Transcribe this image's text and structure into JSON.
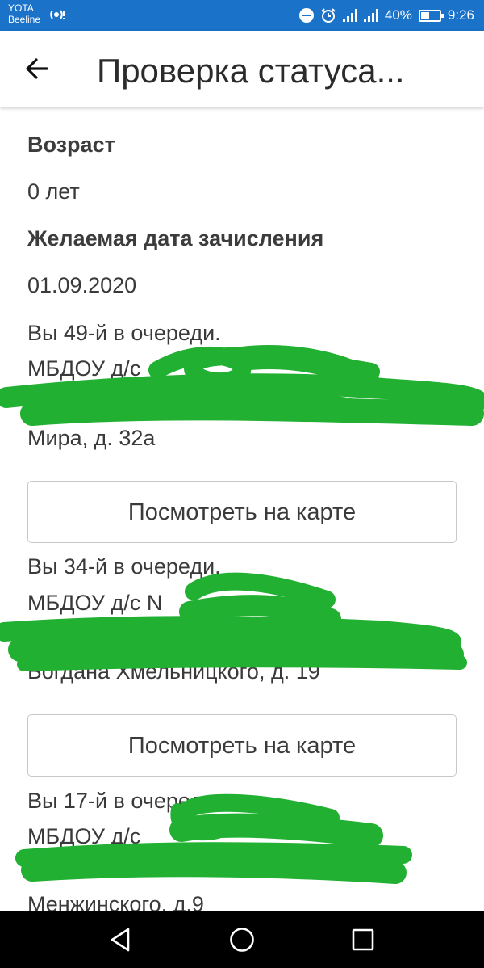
{
  "status_bar": {
    "carrier_1": "YOTA",
    "carrier_2": "Beeline",
    "battery": "40%",
    "time": "9:26",
    "icons": [
      "wifi-hotspot-icon",
      "do-not-disturb-icon",
      "alarm-icon",
      "signal-icon",
      "signal-icon",
      "battery-icon"
    ]
  },
  "toolbar": {
    "back_icon": "arrow-left-icon",
    "title": "Проверка статуса..."
  },
  "details": {
    "age_label": "Возраст",
    "age_value": "0 лет",
    "date_label": "Желаемая дата зачисления",
    "date_value": "01.09.2020"
  },
  "queues": [
    {
      "position": "Вы 49-й в очереди.",
      "kindergarten": "МБДОУ д/с",
      "address_end": "Мира, д. 32а",
      "map_button": "Посмотреть на карте"
    },
    {
      "position": "Вы 34-й в очереди.",
      "kindergarten": "МБДОУ д/с N",
      "address_end": "Богдана Хмельницкого, д. 19",
      "map_button": "Посмотреть на карте"
    },
    {
      "position": "Вы 17-й в очереди.",
      "kindergarten": "МБДОУ д/с",
      "address_end": "Менжинского, д.9"
    }
  ],
  "colors": {
    "status_bar": "#1b72c9",
    "scribble": "#21b031",
    "nav_bar": "#000000"
  },
  "nav_bar": {
    "icons": [
      "back-triangle-icon",
      "home-circle-icon",
      "recents-square-icon"
    ]
  }
}
